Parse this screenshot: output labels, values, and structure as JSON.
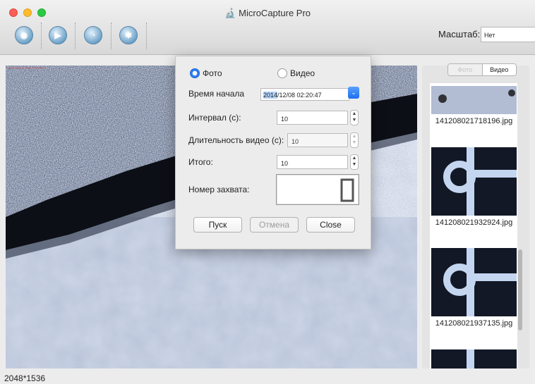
{
  "window": {
    "title": "MicroCapture Pro"
  },
  "toolbar": {
    "icons": [
      "camera-icon",
      "video-camera-icon",
      "timer-icon",
      "settings-icon"
    ],
    "scale_label": "Масштаб:",
    "scale_value": "Нет"
  },
  "status": {
    "resolution": "2048*1536"
  },
  "right_panel": {
    "tab_photo": "Фото",
    "tab_video": "Видео",
    "thumbnails": [
      {
        "filename": "141208021718196.jpg"
      },
      {
        "filename": "141208021932924.jpg"
      },
      {
        "filename": "141208021937135.jpg"
      }
    ]
  },
  "dialog": {
    "photo_label": "Фото",
    "video_label": "Видео",
    "mode_selected": "photo",
    "start_time_label": "Время начала",
    "start_date": "2014",
    "start_rest": "/12/08 02:20:47",
    "interval_label": "Интервал (с):",
    "interval_value": "10",
    "video_duration_label": "Длительность видео (с):",
    "video_duration_value": "10",
    "total_label": "Итого:",
    "total_value": "10",
    "capture_number_label": "Номер захвата:",
    "capture_number_value": "0",
    "start_button": "Пуск",
    "cancel_button": "Отмена",
    "close_button": "Close"
  },
  "colors": {
    "accent": "#2f7fef"
  }
}
